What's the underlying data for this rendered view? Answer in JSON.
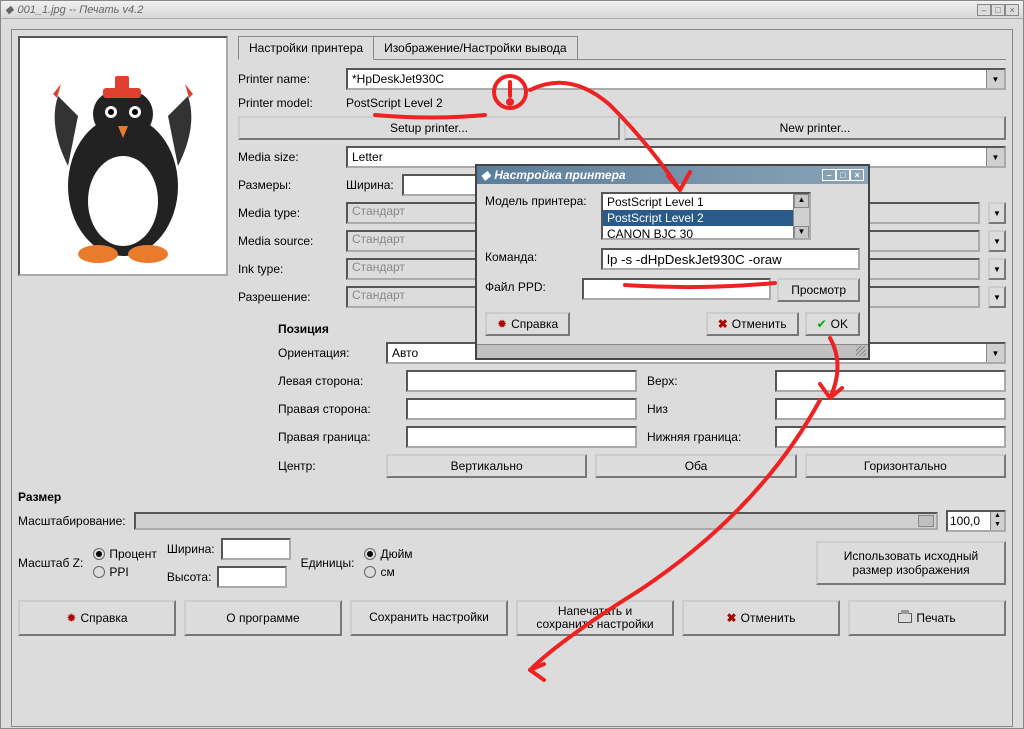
{
  "window": {
    "title": "001_1.jpg -- Печать v4.2"
  },
  "tabs": {
    "printer": "Настройки принтера",
    "output": "Изображение/Настройки вывода"
  },
  "printer": {
    "name_label": "Printer name:",
    "name_value": "*HpDeskJet930C",
    "model_label": "Printer model:",
    "model_value": "PostScript Level 2",
    "setup_btn": "Setup printer...",
    "new_btn": "New printer...",
    "media_size_label": "Media size:",
    "media_size_value": "Letter",
    "dimensions_label": "Размеры:",
    "width_label": "Ширина:",
    "media_type_label": "Media type:",
    "media_type_value": "Стандарт",
    "media_source_label": "Media source:",
    "media_source_value": "Стандарт",
    "ink_type_label": "Ink type:",
    "ink_type_value": "Стандарт",
    "resolution_label": "Разрешение:",
    "resolution_value": "Стандарт"
  },
  "position": {
    "title": "Позиция",
    "orientation_label": "Ориентация:",
    "orientation_value": "Авто",
    "left_label": "Левая сторона:",
    "right_label": "Правая сторона:",
    "right_border_label": "Правая граница:",
    "top_label": "Верх:",
    "bottom_label": "Низ",
    "bottom_border_label": "Нижняя граница:",
    "center_label": "Центр:",
    "vertical_btn": "Вертикально",
    "both_btn": "Оба",
    "horizontal_btn": "Горизонтально"
  },
  "size": {
    "title": "Размер",
    "scaling_label": "Масштабирование:",
    "scaling_value": "100,0",
    "scalez_label": "Масштаб Z:",
    "percent": "Процент",
    "ppi": "PPI",
    "width_label": "Ширина:",
    "height_label": "Высота:",
    "units_label": "Единицы:",
    "inch": "Дюйм",
    "cm": "см",
    "use_original": "Использовать исходный размер изображения"
  },
  "buttons": {
    "help": "Справка",
    "about": "О программе",
    "save_settings": "Сохранить настройки",
    "print_save": "Напечатать и сохранить настройки",
    "cancel": "Отменить",
    "print": "Печать"
  },
  "modal": {
    "title": "Настройка принтера",
    "model_label": "Модель принтера:",
    "models": [
      "PostScript Level 1",
      "PostScript Level 2",
      "CANON BJC 30"
    ],
    "command_label": "Команда:",
    "command_value": "lp -s -dHpDeskJet930C -oraw",
    "ppd_label": "Файл PPD:",
    "browse": "Просмотр",
    "help": "Справка",
    "cancel": "Отменить",
    "ok": "OK"
  }
}
